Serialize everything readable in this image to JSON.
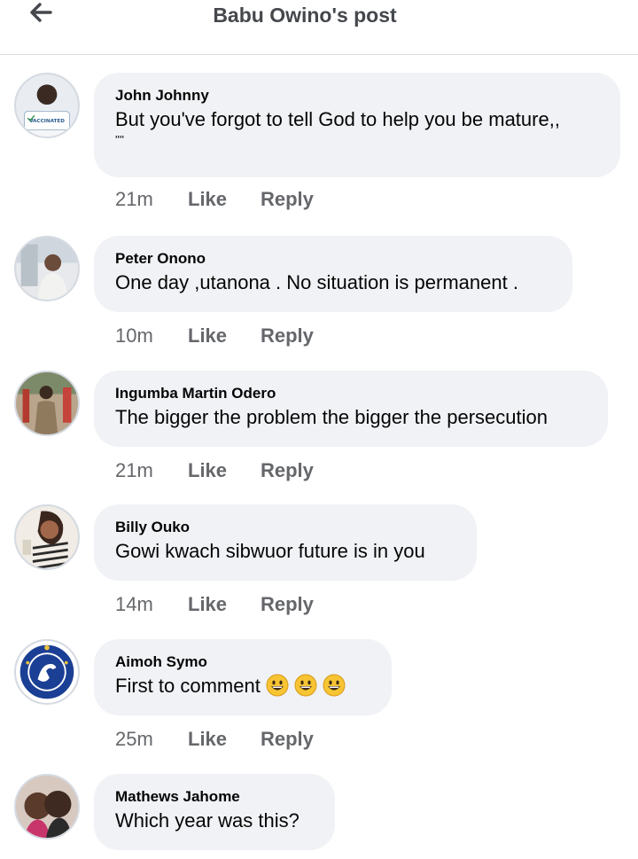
{
  "header": {
    "title": "Babu Owino's post",
    "back_icon": "arrow-left-icon"
  },
  "avatars": {
    "a1_badge": "VACCINATED"
  },
  "comments": [
    {
      "author": "John Johnny",
      "text": "But you've forgot to tell God to help you be mature,,",
      "text_cont": "''''",
      "time": "21m",
      "like": "Like",
      "reply": "Reply"
    },
    {
      "author": "Peter Onono",
      "text": "One day ,utanona . No situation is permanent .",
      "time": "10m",
      "like": "Like",
      "reply": "Reply"
    },
    {
      "author": "Ingumba Martin Odero",
      "text": "The bigger the problem the bigger the persecution",
      "time": "21m",
      "like": "Like",
      "reply": "Reply"
    },
    {
      "author": "Billy Ouko",
      "text": "Gowi kwach sibwuor future is in you",
      "time": "14m",
      "like": "Like",
      "reply": "Reply"
    },
    {
      "author": "Aimoh Symo",
      "text": "First to comment",
      "emoji": [
        "grinning-face-emoji",
        "grinning-face-emoji",
        "grinning-face-emoji"
      ],
      "time": "25m",
      "like": "Like",
      "reply": "Reply"
    },
    {
      "author": "Mathews Jahome",
      "text": "Which year was this?"
    }
  ],
  "colors": {
    "bubble": "#f0f2f5",
    "meta": "#65676b",
    "divider": "#dadde1"
  }
}
